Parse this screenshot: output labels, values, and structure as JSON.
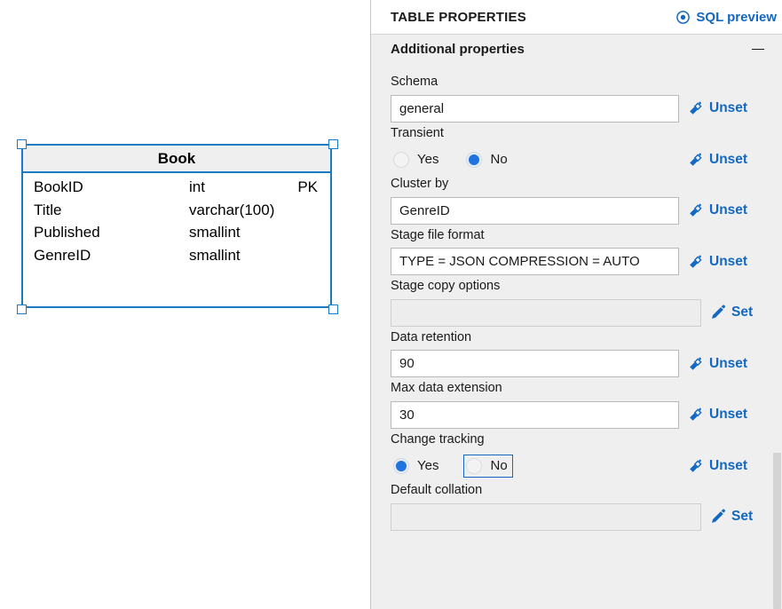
{
  "canvas": {
    "entity": {
      "name": "Book",
      "selected": true,
      "columns": [
        {
          "name": "BookID",
          "type": "int",
          "key": "PK"
        },
        {
          "name": "Title",
          "type": "varchar(100)",
          "key": ""
        },
        {
          "name": "Published",
          "type": "smallint",
          "key": ""
        },
        {
          "name": "GenreID",
          "type": "smallint",
          "key": ""
        }
      ]
    }
  },
  "panel": {
    "title": "TABLE PROPERTIES",
    "sql_preview_label": "SQL preview",
    "sql_preview_icon": "eye-icon",
    "section": {
      "title": "Additional properties",
      "collapse_icon": "minus-icon"
    },
    "set_label": "Set",
    "unset_label": "Unset",
    "set_icon": "pencil-icon",
    "unset_icon": "eraser-icon",
    "fields": [
      {
        "label": "Schema",
        "value": "general",
        "action": "Unset"
      },
      {
        "label": "Cluster by",
        "value": "GenreID",
        "action": "Unset"
      },
      {
        "label": "Stage file format",
        "value": "TYPE = JSON COMPRESSION = AUTO",
        "action": "Unset"
      },
      {
        "label": "Stage copy options",
        "value": "",
        "action": "Set"
      },
      {
        "label": "Data retention",
        "value": "90",
        "action": "Unset"
      },
      {
        "label": "Max data extension",
        "value": "30",
        "action": "Unset"
      },
      {
        "label": "Default collation",
        "value": "",
        "action": "Set"
      }
    ],
    "transient": {
      "label": "Transient",
      "options": [
        "Yes",
        "No"
      ],
      "selected": "No",
      "action": "Unset"
    },
    "change_tracking": {
      "label": "Change tracking",
      "options": [
        "Yes",
        "No"
      ],
      "selected": "Yes",
      "focused": "No",
      "action": "Unset"
    }
  },
  "colors": {
    "accent": "#1268c3",
    "selection": "#1a7ac4",
    "radio_fill": "#1f72df",
    "panel_bg": "#efefef"
  }
}
